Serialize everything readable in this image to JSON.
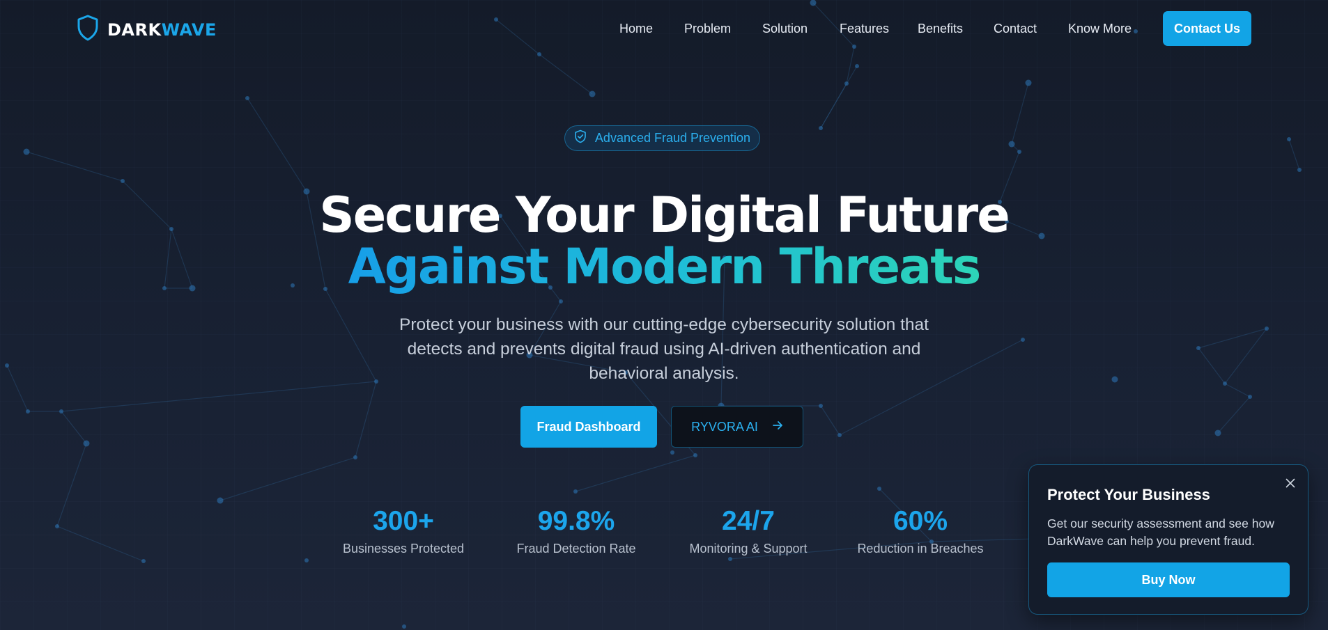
{
  "brand": {
    "name_part1": "DARK",
    "name_part2": "WAVE",
    "logo_icon": "shield-icon",
    "accent_color": "#12a4e6"
  },
  "nav": {
    "links": [
      "Home",
      "Problem",
      "Solution",
      "Features",
      "Benefits",
      "Contact",
      "Know More"
    ],
    "cta_label": "Contact Us"
  },
  "hero": {
    "badge_icon": "shield-check-icon",
    "badge_label": "Advanced Fraud Prevention",
    "title_line1": "Secure Your Digital Future",
    "title_line2": "Against Modern Threats",
    "description": "Protect your business with our cutting-edge cybersecurity solution that detects and prevents digital fraud using AI-driven authentication and behavioral analysis.",
    "primary_button": "Fraud Dashboard",
    "secondary_button": "RYVORA AI",
    "secondary_button_icon": "arrow-right-icon"
  },
  "stats": [
    {
      "value": "300+",
      "label": "Businesses Protected"
    },
    {
      "value": "99.8%",
      "label": "Fraud Detection Rate"
    },
    {
      "value": "24/7",
      "label": "Monitoring & Support"
    },
    {
      "value": "60%",
      "label": "Reduction in Breaches"
    }
  ],
  "popup": {
    "title": "Protect Your Business",
    "description": "Get our security assessment and see how DarkWave can help you prevent fraud.",
    "button": "Buy Now",
    "close_icon": "close-icon"
  }
}
